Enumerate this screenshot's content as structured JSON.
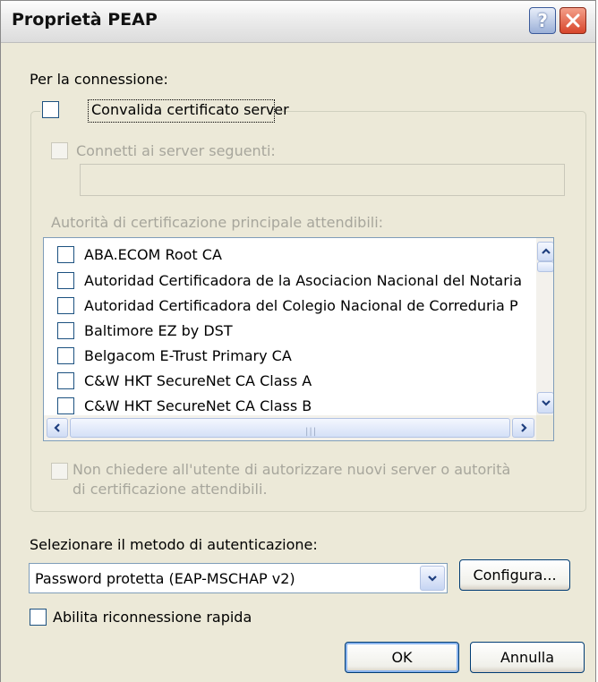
{
  "window": {
    "title": "Proprietà PEAP",
    "help_glyph": "?",
    "close_icon": "close-icon"
  },
  "connection": {
    "section_label": "Per la connessione:",
    "validate_cert": {
      "label": "Convalida certificato server",
      "checked": false
    },
    "connect_servers": {
      "label": "Connetti ai server seguenti:",
      "checked": false,
      "enabled": false,
      "value": ""
    },
    "trusted_ca_label": "Autorità di certificazione principale attendibili:",
    "ca_list": [
      {
        "name": "ABA.ECOM Root CA",
        "checked": false
      },
      {
        "name": "Autoridad Certificadora de la Asociacion Nacional del Notaria",
        "checked": false
      },
      {
        "name": "Autoridad Certificadora del Colegio Nacional de Correduria P",
        "checked": false
      },
      {
        "name": "Baltimore EZ by DST",
        "checked": false
      },
      {
        "name": "Belgacom E-Trust Primary CA",
        "checked": false
      },
      {
        "name": "C&W HKT SecureNet CA Class A",
        "checked": false
      },
      {
        "name": "C&W HKT SecureNet CA Class B",
        "checked": false
      }
    ],
    "no_prompt": {
      "line1": "Non chiedere all'utente di autorizzare nuovi server o autorità",
      "line2": "di certificazione attendibili.",
      "checked": false,
      "enabled": false
    }
  },
  "auth": {
    "method_label": "Selezionare il metodo di autenticazione:",
    "method_value": "Password protetta (EAP-MSCHAP v2)",
    "configure_label": "Configura...",
    "fast_reconnect": {
      "label": "Abilita riconnessione rapida",
      "checked": false
    }
  },
  "buttons": {
    "ok": "OK",
    "cancel": "Annulla"
  },
  "colors": {
    "dialog_bg": "#ece9d8",
    "border_blue": "#7f9db9",
    "disabled_text": "#a7a69c"
  }
}
